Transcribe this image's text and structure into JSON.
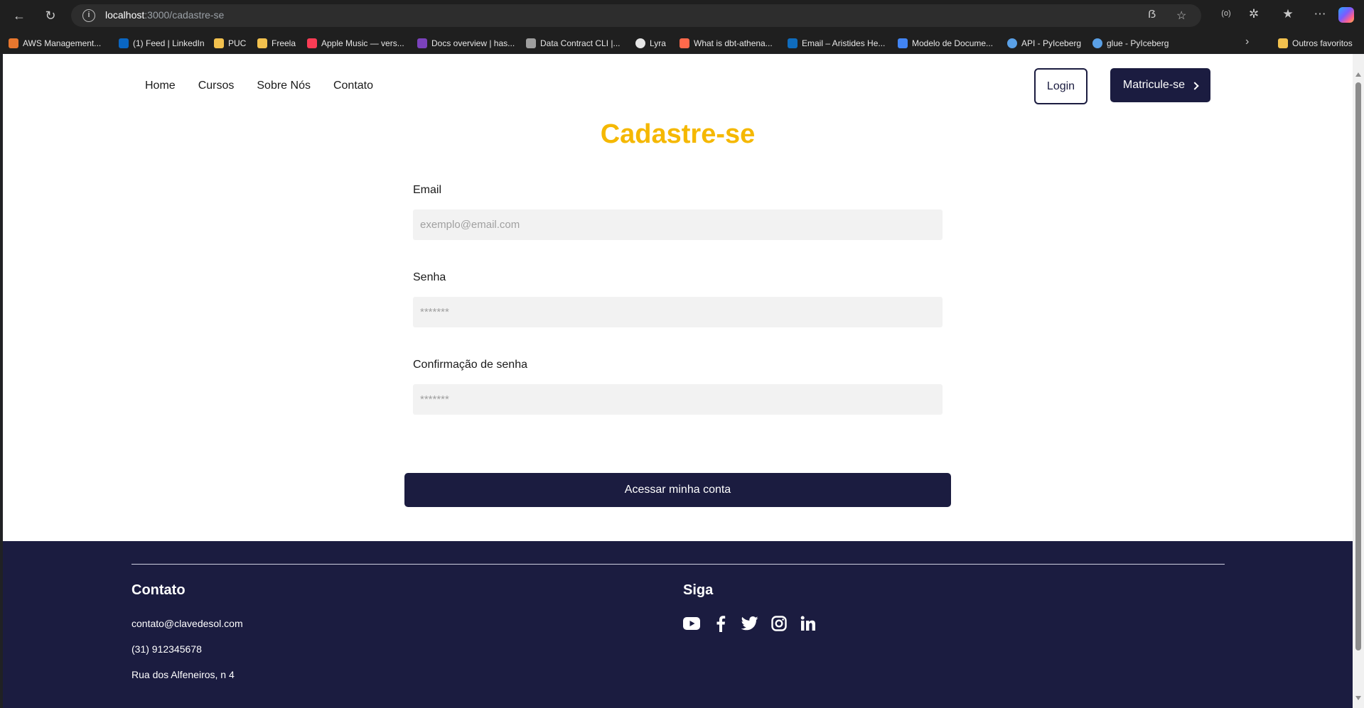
{
  "browser": {
    "url_host": "localhost",
    "url_path": ":3000/cadastre-se",
    "bookmarks": [
      {
        "label": "AWS Management...",
        "color": "#e8772e"
      },
      {
        "label": "(1) Feed | LinkedIn",
        "color": "#0a66c2"
      },
      {
        "label": "PUC",
        "color": "#f2c14e"
      },
      {
        "label": "Freela",
        "color": "#f2c14e"
      },
      {
        "label": "Apple Music — vers...",
        "color": "#fa3c55"
      },
      {
        "label": "Docs overview | has...",
        "color": "#7b42bc"
      },
      {
        "label": "Data Contract CLI |...",
        "color": "#9e9e9e"
      },
      {
        "label": "Lyra",
        "color": "#e6e6e6"
      },
      {
        "label": "What is dbt-athena...",
        "color": "#ff694b"
      },
      {
        "label": "Email – Aristides He...",
        "color": "#0f6cbd"
      },
      {
        "label": "Modelo de Docume...",
        "color": "#4285f4"
      },
      {
        "label": "API - PyIceberg",
        "color": "#5aa0e6"
      },
      {
        "label": "glue - PyIceberg",
        "color": "#5aa0e6"
      }
    ],
    "other_favorites": "Outros favoritos"
  },
  "site": {
    "nav": {
      "home": "Home",
      "courses": "Cursos",
      "about": "Sobre Nós",
      "contact": "Contato"
    },
    "login_label": "Login",
    "enroll_label": "Matricule-se",
    "brand_color": "#1b1c40",
    "accent_color": "#f5b800"
  },
  "form": {
    "title": "Cadastre-se",
    "email_label": "Email",
    "email_placeholder": "exemplo@email.com",
    "password_label": "Senha",
    "password_placeholder": "*******",
    "confirm_label": "Confirmação de senha",
    "confirm_placeholder": "*******",
    "submit_label": "Acessar minha conta"
  },
  "footer": {
    "contact_heading": "Contato",
    "email": "contato@clavedesol.com",
    "phone": "(31) 912345678",
    "address": "Rua dos Alfeneiros, n 4",
    "follow_heading": "Siga",
    "social_icons": [
      "youtube-icon",
      "facebook-icon",
      "twitter-icon",
      "instagram-icon",
      "linkedin-icon"
    ]
  }
}
